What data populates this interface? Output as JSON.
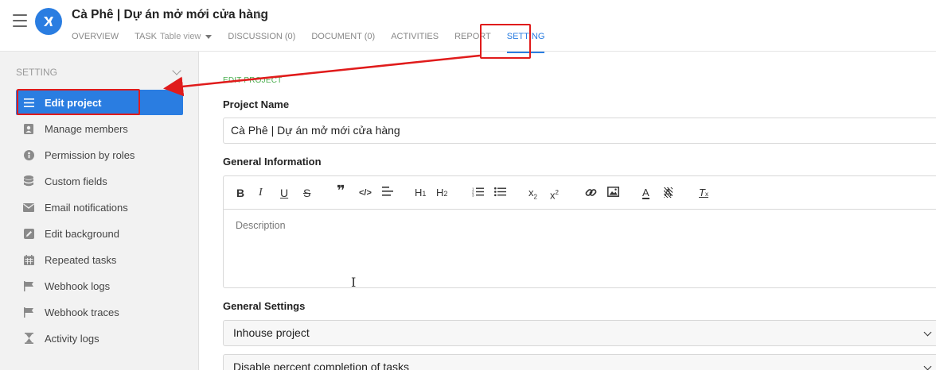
{
  "header": {
    "title": "Cà Phê | Dự án mở mới cửa hàng",
    "tabs": [
      {
        "label": "OVERVIEW"
      },
      {
        "label": "TASK",
        "sub": "Table view"
      },
      {
        "label": "DISCUSSION (0)"
      },
      {
        "label": "DOCUMENT (0)"
      },
      {
        "label": "ACTIVITIES"
      },
      {
        "label": "REPORT"
      },
      {
        "label": "SETTING",
        "active": true
      }
    ]
  },
  "sidebar": {
    "heading": "SETTING",
    "items": [
      {
        "label": "Edit project",
        "icon": "list-icon",
        "active": true
      },
      {
        "label": "Manage members",
        "icon": "members-icon"
      },
      {
        "label": "Permission by roles",
        "icon": "permission-icon"
      },
      {
        "label": "Custom fields",
        "icon": "database-icon"
      },
      {
        "label": "Email notifications",
        "icon": "email-icon"
      },
      {
        "label": "Edit background",
        "icon": "edit-icon"
      },
      {
        "label": "Repeated tasks",
        "icon": "calendar-icon"
      },
      {
        "label": "Webhook logs",
        "icon": "flag-icon"
      },
      {
        "label": "Webhook traces",
        "icon": "flag-icon"
      },
      {
        "label": "Activity logs",
        "icon": "hourglass-icon"
      }
    ]
  },
  "main": {
    "section_label": "EDIT PROJECT",
    "project_name_label": "Project Name",
    "project_name_value": "Cà Phê | Dự án mở mới cửa hàng",
    "general_info_label": "General Information",
    "description_placeholder": "Description",
    "general_settings_label": "General Settings",
    "project_type": "Inhouse project",
    "percent_completion": "Disable percent completion of tasks"
  },
  "colors": {
    "accent": "#2a7de1",
    "annotation": "#e01b1b",
    "section_label": "#4caf50"
  }
}
